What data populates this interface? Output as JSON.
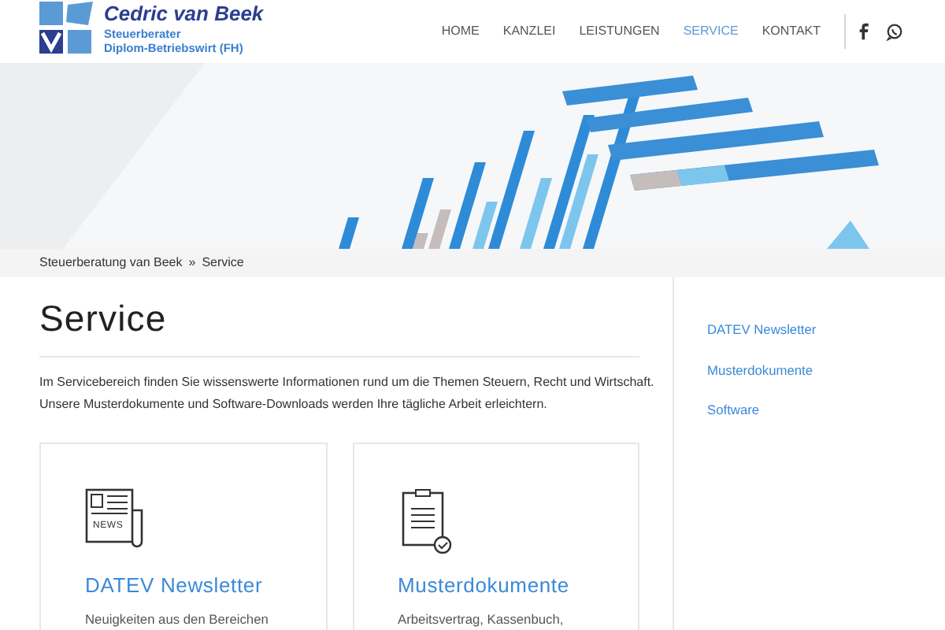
{
  "logo": {
    "name": "Cedric van Beek",
    "subtitle_lines": [
      "Steuerberater",
      "Diplom-Betriebswirt (FH)"
    ]
  },
  "nav": [
    {
      "label": "HOME",
      "selected": false
    },
    {
      "label": "KANZLEI",
      "selected": false
    },
    {
      "label": "LEISTUNGEN",
      "selected": false
    },
    {
      "label": "SERVICE",
      "selected": true
    },
    {
      "label": "KONTAKT",
      "selected": false
    }
  ],
  "social": [
    {
      "kind": "facebook"
    },
    {
      "kind": "whatsapp"
    }
  ],
  "hero": {
    "kind": "picture"
  },
  "breadcrumb": [
    "Steuerberatung van Beek",
    "Service"
  ],
  "breadcrumb_separator": "»",
  "page_title": "Service",
  "intro_lines": [
    "Im Servicebereich finden Sie wissenswerte Informationen rund um die Themen Steuern, Recht und Wirtschaft.",
    "Unsere Musterdokumente und Software-Downloads werden Ihre tägliche Arbeit erleichtern."
  ],
  "cards": [
    {
      "kind": "newspaper",
      "icon_label": "NEWS",
      "title": "DATEV Newsletter",
      "text": "Neuigkeiten aus den Bereichen"
    },
    {
      "kind": "clipboard",
      "title": "Musterdokumente",
      "text": "Arbeitsvertrag, Kassenbuch,"
    }
  ],
  "sidebar": {
    "items": [
      "DATEV Newsletter",
      "Musterdokumente",
      "Software"
    ]
  }
}
